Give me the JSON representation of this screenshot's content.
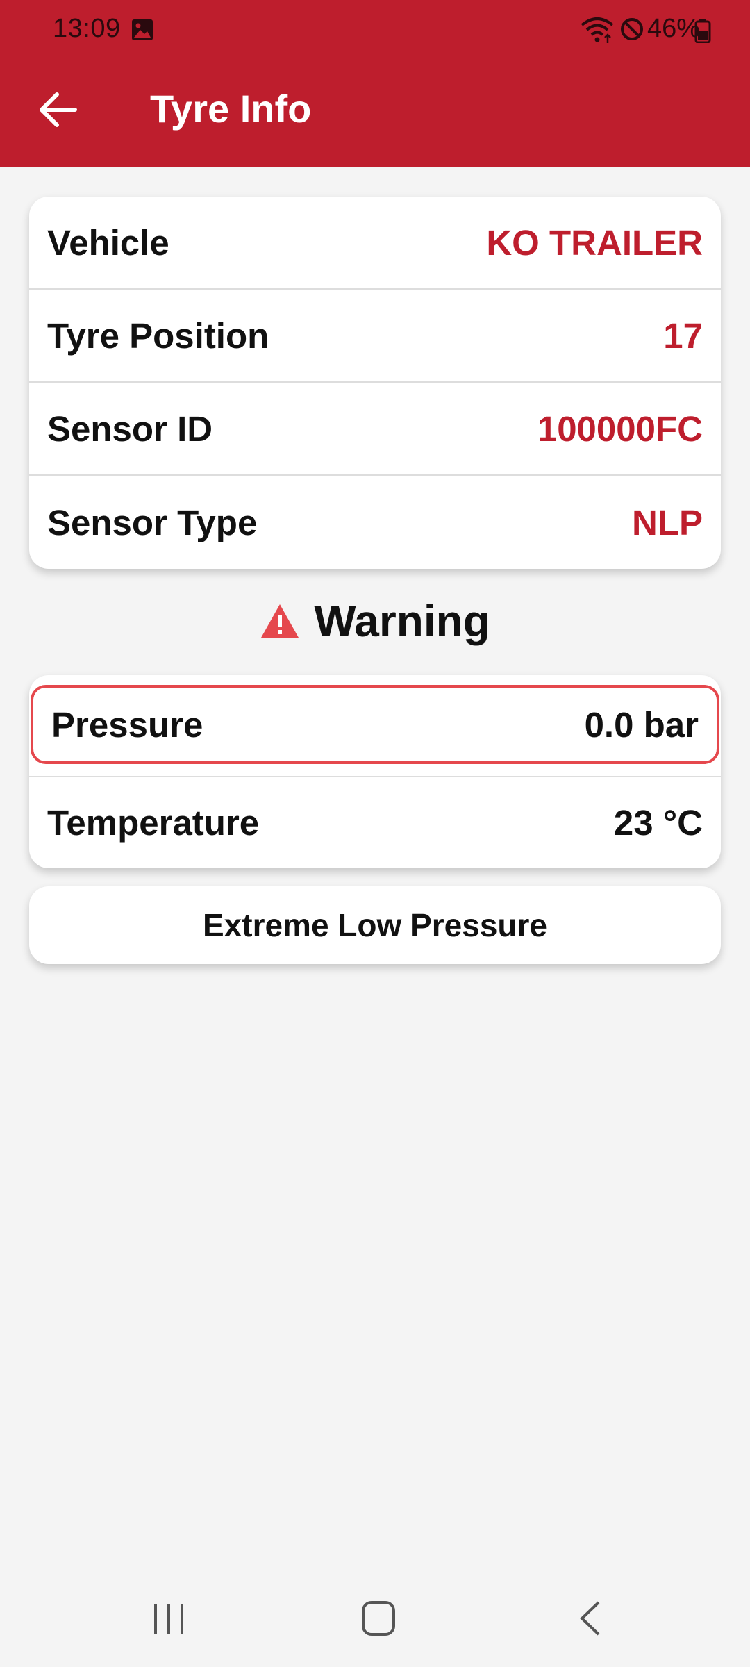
{
  "status_bar": {
    "time": "13:09",
    "battery": "46%",
    "icons": [
      "gallery-icon",
      "wifi-icon",
      "do-not-disturb-icon",
      "battery-icon"
    ]
  },
  "header": {
    "title": "Tyre Info",
    "back_icon": "arrow-left-icon",
    "color": "#be1e2d"
  },
  "info": {
    "rows": [
      {
        "label": "Vehicle",
        "value": "KO TRAILER"
      },
      {
        "label": "Tyre Position",
        "value": "17"
      },
      {
        "label": "Sensor ID",
        "value": "100000FC"
      },
      {
        "label": "Sensor Type",
        "value": "NLP"
      }
    ],
    "value_color": "#be1e2d"
  },
  "warning": {
    "title": "Warning",
    "icon": "warning-triangle-icon",
    "color": "#e5484d"
  },
  "readings": {
    "pressure": {
      "label": "Pressure",
      "value": "0.0 bar"
    },
    "temperature": {
      "label": "Temperature",
      "value": "23 °C"
    }
  },
  "alert": {
    "text": "Extreme Low Pressure"
  },
  "nav_bar": {
    "icons": [
      "recent-apps-icon",
      "home-icon",
      "back-icon"
    ]
  }
}
